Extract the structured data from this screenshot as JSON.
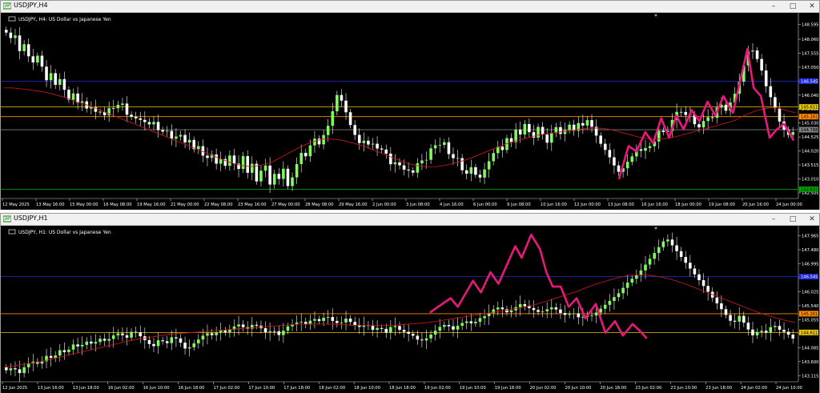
{
  "windows": [
    {
      "title": "USDJPY,H4",
      "header": "USDJPY, H4:  US Dollar vs Japanese Yen",
      "buttons": [
        "minimize",
        "maximize",
        "close"
      ],
      "price_axis": [
        "148.595",
        "148.060",
        "147.555",
        "147.050",
        "146.545",
        "146.040",
        "145.535",
        "145.030",
        "144.525",
        "144.020",
        "143.515",
        "143.010",
        "142.505"
      ],
      "price_tags": [
        {
          "label": "145.611",
          "color": "#e8c300",
          "price": 145.611
        },
        {
          "label": "145.261",
          "color": "#ff8c00",
          "price": 145.261
        },
        {
          "label": "144.788",
          "color": "#808080",
          "price": 144.788
        },
        {
          "label": "146.545",
          "color": "#1e2bd6",
          "price": 146.545
        },
        {
          "label": "142.631",
          "color": "#00a000",
          "price": 142.631
        }
      ],
      "time_axis": [
        "12 May 2025",
        "13 May 16:00",
        "15 May 00:00",
        "16 May 08:00",
        "19 May 16:00",
        "21 May 00:00",
        "22 May 08:00",
        "23 May 16:00",
        "27 May 00:00",
        "28 May 08:00",
        "29 May 16:00",
        "2 Jun 00:00",
        "3 Jun 08:00",
        "4 Jun 16:00",
        "6 Jun 00:00",
        "9 Jun 08:00",
        "10 Jun 16:00",
        "12 Jun 00:00",
        "13 Jun 08:00",
        "16 Jun 16:00",
        "18 Jun 00:00",
        "19 Jun 08:00",
        "20 Jun 16:00",
        "24 Jun 00:00"
      ]
    },
    {
      "title": "USDJPY,H1",
      "header": "USDJPY, H1:  US Dollar vs Japanese Yen",
      "buttons": [
        "minimize",
        "maximize",
        "close"
      ],
      "price_axis": [
        "147.965",
        "147.480",
        "146.995",
        "146.510",
        "146.025",
        "145.540",
        "145.055",
        "144.570",
        "144.085",
        "143.600",
        "143.115"
      ],
      "price_tags": [
        {
          "label": "145.261",
          "color": "#ff8c00",
          "price": 145.261
        },
        {
          "label": "144.611",
          "color": "#e8c300",
          "price": 144.611
        },
        {
          "label": "146.545",
          "color": "#1e2bd6",
          "price": 146.545
        }
      ],
      "time_axis": [
        "12 Jun 2025",
        "13 Jun 16:00",
        "13 Jun 18:00",
        "16 Jun 02:00",
        "16 Jun 10:00",
        "16 Jun 18:00",
        "17 Jun 02:00",
        "17 Jun 10:00",
        "17 Jun 18:00",
        "18 Jun 02:00",
        "18 Jun 10:00",
        "18 Jun 18:00",
        "19 Jun 02:00",
        "19 Jun 10:00",
        "19 Jun 18:00",
        "20 Jun 02:00",
        "20 Jun 10:00",
        "20 Jun 18:00",
        "23 Jun 02:00",
        "23 Jun 10:00",
        "23 Jun 18:00",
        "24 Jun 02:00",
        "24 Jun 10:00"
      ]
    }
  ],
  "chart_data": [
    {
      "type": "candlestick",
      "symbol": "USDJPY",
      "timeframe": "H4",
      "ylim": [
        142.3,
        148.9
      ],
      "levels": [
        146.545,
        145.611,
        145.261,
        144.788,
        142.631
      ],
      "close_path": [
        148.3,
        148.1,
        148.2,
        147.6,
        147.9,
        147.4,
        147.2,
        147.5,
        147.0,
        146.5,
        146.9,
        146.3,
        146.7,
        146.1,
        145.8,
        146.2,
        145.6,
        145.9,
        145.4,
        145.7,
        145.3,
        145.5,
        145.2,
        145.8,
        145.4,
        145.9,
        145.6,
        145.1,
        145.4,
        145.0,
        145.3,
        144.8,
        145.2,
        144.9,
        144.6,
        144.9,
        144.5,
        144.4,
        144.8,
        144.2,
        144.6,
        144.0,
        144.3,
        143.9,
        143.7,
        144.0,
        143.5,
        143.8,
        143.4,
        143.9,
        143.6,
        143.3,
        143.9,
        143.2,
        143.6,
        142.9,
        143.3,
        143.5,
        142.8,
        143.2,
        143.0,
        143.4,
        142.7,
        143.1,
        143.6,
        144.0,
        143.8,
        144.3,
        144.5,
        144.2,
        144.7,
        145.0,
        145.6,
        146.2,
        145.7,
        145.3,
        144.8,
        144.5,
        144.2,
        144.5,
        144.1,
        144.4,
        143.9,
        144.2,
        143.7,
        143.4,
        143.8,
        143.2,
        143.5,
        143.1,
        143.4,
        143.8,
        143.5,
        144.0,
        144.3,
        144.1,
        144.5,
        144.0,
        143.7,
        143.9,
        143.4,
        143.1,
        143.5,
        143.2,
        143.0,
        143.3,
        143.6,
        143.9,
        144.2,
        144.0,
        144.5,
        144.3,
        144.8,
        144.6,
        145.0,
        144.7,
        144.5,
        144.9,
        144.6,
        144.3,
        144.7,
        144.9,
        144.6,
        144.8,
        145.0,
        144.7,
        145.1,
        144.9,
        145.2,
        144.8,
        144.5,
        144.2,
        144.0,
        143.7,
        143.4,
        143.2,
        143.5,
        143.7,
        143.9,
        144.2,
        143.9,
        144.3,
        144.1,
        144.6,
        144.9,
        144.5,
        145.0,
        145.3,
        145.6,
        145.2,
        145.5,
        145.1,
        144.8,
        145.0,
        145.3,
        145.1,
        145.5,
        145.8,
        145.4,
        145.7,
        146.0,
        146.4,
        147.0,
        147.6,
        147.7,
        147.4,
        147.0,
        146.4,
        146.0,
        145.6,
        145.1,
        144.8,
        144.6,
        144.7
      ],
      "ma_path": [
        146.3,
        146.3,
        146.25,
        146.2,
        146.15,
        146.05,
        145.95,
        145.8,
        145.7,
        145.55,
        145.4,
        145.25,
        145.1,
        144.95,
        144.8,
        144.65,
        144.5,
        144.35,
        144.2,
        144.05,
        143.9,
        143.75,
        143.6,
        143.5,
        143.45,
        143.5,
        143.6,
        143.8,
        144.0,
        144.2,
        144.35,
        144.45,
        144.45,
        144.4,
        144.3,
        144.2,
        144.05,
        143.9,
        143.75,
        143.6,
        143.5,
        143.45,
        143.45,
        143.5,
        143.6,
        143.7,
        143.85,
        144.0,
        144.15,
        144.3,
        144.4,
        144.5,
        144.6,
        144.65,
        144.7,
        144.75,
        144.8,
        144.85,
        144.85,
        144.8,
        144.7,
        144.6,
        144.5,
        144.45,
        144.45,
        144.5,
        144.6,
        144.7,
        144.8,
        144.9,
        145.0,
        145.1,
        145.3,
        145.45,
        145.55,
        145.6,
        145.5,
        145.4
      ],
      "annotations": [
        {
          "type": "zigzag",
          "color": "#e8197a",
          "points": [
            [
              0.775,
              143.0
            ],
            [
              0.787,
              144.2
            ],
            [
              0.797,
              144.0
            ],
            [
              0.808,
              144.7
            ],
            [
              0.818,
              144.3
            ],
            [
              0.828,
              145.2
            ],
            [
              0.838,
              144.5
            ],
            [
              0.847,
              145.3
            ],
            [
              0.856,
              144.8
            ],
            [
              0.866,
              145.5
            ],
            [
              0.876,
              145.1
            ],
            [
              0.886,
              145.8
            ],
            [
              0.896,
              145.3
            ],
            [
              0.906,
              146.0
            ],
            [
              0.918,
              145.4
            ],
            [
              0.936,
              147.7
            ],
            [
              0.944,
              146.3
            ],
            [
              0.953,
              146.0
            ],
            [
              0.964,
              144.5
            ],
            [
              0.973,
              144.8
            ],
            [
              0.982,
              145.0
            ],
            [
              0.994,
              144.4
            ]
          ]
        }
      ]
    },
    {
      "type": "candlestick",
      "symbol": "USDJPY",
      "timeframe": "H1",
      "ylim": [
        142.9,
        148.2
      ],
      "levels": [
        146.545,
        145.261,
        144.611
      ],
      "close_path": [
        143.3,
        143.4,
        143.2,
        143.5,
        143.6,
        143.5,
        143.8,
        143.7,
        144.0,
        143.9,
        144.2,
        144.1,
        144.3,
        144.2,
        144.4,
        144.3,
        144.5,
        144.6,
        144.4,
        144.7,
        144.5,
        144.3,
        144.1,
        144.4,
        144.2,
        144.5,
        144.3,
        144.0,
        144.2,
        144.4,
        144.6,
        144.5,
        144.7,
        144.6,
        144.8,
        144.9,
        144.7,
        144.9,
        144.8,
        144.6,
        144.7,
        144.5,
        144.8,
        144.9,
        145.0,
        144.9,
        145.1,
        145.0,
        145.2,
        145.0,
        144.9,
        145.1,
        144.9,
        144.8,
        144.9,
        144.7,
        144.8,
        144.6,
        144.9,
        144.7,
        144.6,
        144.5,
        144.3,
        144.4,
        144.6,
        144.8,
        144.9,
        144.7,
        144.9,
        145.0,
        144.9,
        145.1,
        145.2,
        145.4,
        145.5,
        145.3,
        145.4,
        145.6,
        145.5,
        145.4,
        145.3,
        145.4,
        145.5,
        145.3,
        145.2,
        145.3,
        145.1,
        145.2,
        145.2,
        145.4,
        145.6,
        145.8,
        146.0,
        146.3,
        146.5,
        146.7,
        147.0,
        147.3,
        147.6,
        147.9,
        147.6,
        147.3,
        147.0,
        146.7,
        146.4,
        146.1,
        145.8,
        145.5,
        145.2,
        144.9,
        145.2,
        144.8,
        144.5,
        144.7,
        144.6,
        144.9,
        144.7,
        144.6,
        144.4
      ],
      "ma_path": [
        143.4,
        143.5,
        143.6,
        143.75,
        143.9,
        144.05,
        144.2,
        144.35,
        144.45,
        144.55,
        144.6,
        144.65,
        144.7,
        144.75,
        144.8,
        144.85,
        144.9,
        144.9,
        144.9,
        144.85,
        144.85,
        144.85,
        144.9,
        144.95,
        145.05,
        145.15,
        145.25,
        145.35,
        145.45,
        145.6,
        145.8,
        146.0,
        146.25,
        146.45,
        146.6,
        146.6,
        146.5,
        146.3,
        146.05,
        145.8,
        145.55,
        145.3,
        145.1,
        144.95
      ],
      "annotations": [
        {
          "type": "zigzag",
          "color": "#e8197a",
          "points": [
            [
              0.538,
              145.3
            ],
            [
              0.564,
              145.8
            ],
            [
              0.573,
              145.5
            ],
            [
              0.592,
              146.4
            ],
            [
              0.602,
              146.0
            ],
            [
              0.614,
              146.7
            ],
            [
              0.624,
              146.3
            ],
            [
              0.645,
              147.6
            ],
            [
              0.653,
              147.2
            ],
            [
              0.665,
              148.0
            ],
            [
              0.676,
              147.5
            ],
            [
              0.684,
              146.7
            ],
            [
              0.692,
              146.2
            ],
            [
              0.702,
              146.2
            ],
            [
              0.712,
              145.5
            ],
            [
              0.722,
              145.8
            ],
            [
              0.733,
              145.1
            ],
            [
              0.746,
              145.6
            ],
            [
              0.758,
              144.6
            ],
            [
              0.77,
              145.0
            ],
            [
              0.78,
              144.5
            ],
            [
              0.792,
              144.9
            ],
            [
              0.8,
              144.7
            ],
            [
              0.81,
              144.4
            ]
          ]
        }
      ]
    }
  ]
}
